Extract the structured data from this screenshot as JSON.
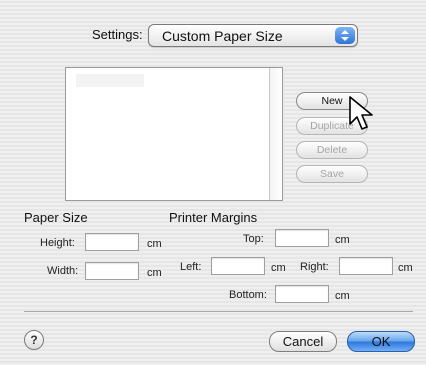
{
  "settings": {
    "label": "Settings:",
    "selected": "Custom Paper Size"
  },
  "paper_list": {
    "items": []
  },
  "list_buttons": {
    "new": "New",
    "duplicate": "Duplicate",
    "delete": "Delete",
    "save": "Save"
  },
  "paper_size": {
    "heading": "Paper Size",
    "height_label": "Height:",
    "height_value": "",
    "width_label": "Width:",
    "width_value": "",
    "unit": "cm"
  },
  "printer_margins": {
    "heading": "Printer Margins",
    "top_label": "Top:",
    "left_label": "Left:",
    "right_label": "Right:",
    "bottom_label": "Bottom:",
    "top_value": "",
    "left_value": "",
    "right_value": "",
    "bottom_value": "",
    "unit": "cm"
  },
  "footer": {
    "help": "?",
    "cancel": "Cancel",
    "ok": "OK"
  },
  "icons": {
    "help": "help-icon",
    "popup_arrows": "updown-arrows-icon",
    "cursor": "hand-pointer-icon"
  },
  "colors": {
    "default_button": "#3b82e6",
    "background": "#ececec"
  }
}
